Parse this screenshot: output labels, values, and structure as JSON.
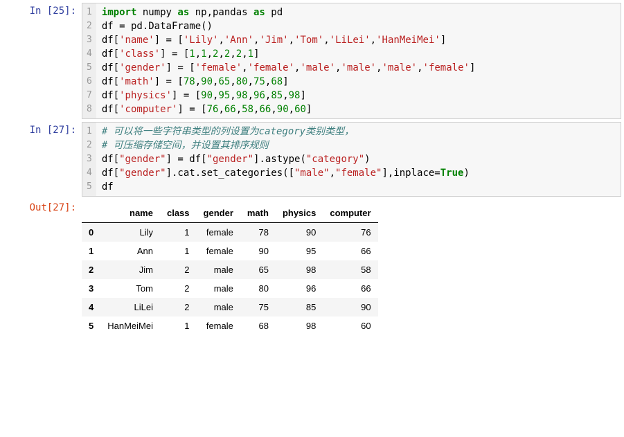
{
  "cell1": {
    "prompt": "In [25]:",
    "lines": [
      "1",
      "2",
      "3",
      "4",
      "5",
      "6",
      "7",
      "8"
    ],
    "code": {
      "l1_a": "import",
      "l1_b": " numpy ",
      "l1_c": "as",
      "l1_d": " np,pandas ",
      "l1_e": "as",
      "l1_f": " pd",
      "l2": "df = pd.DataFrame()",
      "l3_a": "df[",
      "l3_b": "'name'",
      "l3_c": "] = [",
      "l3_d": "'Lily'",
      "l3_e": ",",
      "l3_f": "'Ann'",
      "l3_g": ",",
      "l3_h": "'Jim'",
      "l3_i": ",",
      "l3_j": "'Tom'",
      "l3_k": ",",
      "l3_l": "'LiLei'",
      "l3_m": ",",
      "l3_n": "'HanMeiMei'",
      "l3_o": "]",
      "l4_a": "df[",
      "l4_b": "'class'",
      "l4_c": "] = [",
      "l4_d": "1",
      "l4_e": ",",
      "l4_f": "1",
      "l4_g": ",",
      "l4_h": "2",
      "l4_i": ",",
      "l4_j": "2",
      "l4_k": ",",
      "l4_l": "2",
      "l4_m": ",",
      "l4_n": "1",
      "l4_o": "]",
      "l5_a": "df[",
      "l5_b": "'gender'",
      "l5_c": "] = [",
      "l5_d": "'female'",
      "l5_e": ",",
      "l5_f": "'female'",
      "l5_g": ",",
      "l5_h": "'male'",
      "l5_i": ",",
      "l5_j": "'male'",
      "l5_k": ",",
      "l5_l": "'male'",
      "l5_m": ",",
      "l5_n": "'female'",
      "l5_o": "]",
      "l6_a": "df[",
      "l6_b": "'math'",
      "l6_c": "] = [",
      "l6_d": "78",
      "l6_e": ",",
      "l6_f": "90",
      "l6_g": ",",
      "l6_h": "65",
      "l6_i": ",",
      "l6_j": "80",
      "l6_k": ",",
      "l6_l": "75",
      "l6_m": ",",
      "l6_n": "68",
      "l6_o": "]",
      "l7_a": "df[",
      "l7_b": "'physics'",
      "l7_c": "] = [",
      "l7_d": "90",
      "l7_e": ",",
      "l7_f": "95",
      "l7_g": ",",
      "l7_h": "98",
      "l7_i": ",",
      "l7_j": "96",
      "l7_k": ",",
      "l7_l": "85",
      "l7_m": ",",
      "l7_n": "98",
      "l7_o": "]",
      "l8_a": "df[",
      "l8_b": "'computer'",
      "l8_c": "] = [",
      "l8_d": "76",
      "l8_e": ",",
      "l8_f": "66",
      "l8_g": ",",
      "l8_h": "58",
      "l8_i": ",",
      "l8_j": "66",
      "l8_k": ",",
      "l8_l": "90",
      "l8_m": ",",
      "l8_n": "60",
      "l8_o": "]"
    }
  },
  "cell2": {
    "prompt": "In [27]:",
    "lines": [
      "1",
      "2",
      "3",
      "4",
      "5"
    ],
    "code": {
      "c1": "# 可以将一些字符串类型的列设置为category类别类型，",
      "c2": "# 可压缩存储空间，并设置其排序规则",
      "l3_a": "df[",
      "l3_b": "\"gender\"",
      "l3_c": "] = df[",
      "l3_d": "\"gender\"",
      "l3_e": "].astype(",
      "l3_f": "\"category\"",
      "l3_g": ")",
      "l4_a": "df[",
      "l4_b": "\"gender\"",
      "l4_c": "].cat.set_categories([",
      "l4_d": "\"male\"",
      "l4_e": ",",
      "l4_f": "\"female\"",
      "l4_g": "],inplace=",
      "l4_h": "True",
      "l4_i": ")",
      "l5": "df"
    }
  },
  "out": {
    "prompt": "Out[27]:"
  },
  "chart_data": {
    "type": "table",
    "columns": [
      "",
      "name",
      "class",
      "gender",
      "math",
      "physics",
      "computer"
    ],
    "rows": [
      [
        "0",
        "Lily",
        "1",
        "female",
        "78",
        "90",
        "76"
      ],
      [
        "1",
        "Ann",
        "1",
        "female",
        "90",
        "95",
        "66"
      ],
      [
        "2",
        "Jim",
        "2",
        "male",
        "65",
        "98",
        "58"
      ],
      [
        "3",
        "Tom",
        "2",
        "male",
        "80",
        "96",
        "66"
      ],
      [
        "4",
        "LiLei",
        "2",
        "male",
        "75",
        "85",
        "90"
      ],
      [
        "5",
        "HanMeiMei",
        "1",
        "female",
        "68",
        "98",
        "60"
      ]
    ]
  }
}
